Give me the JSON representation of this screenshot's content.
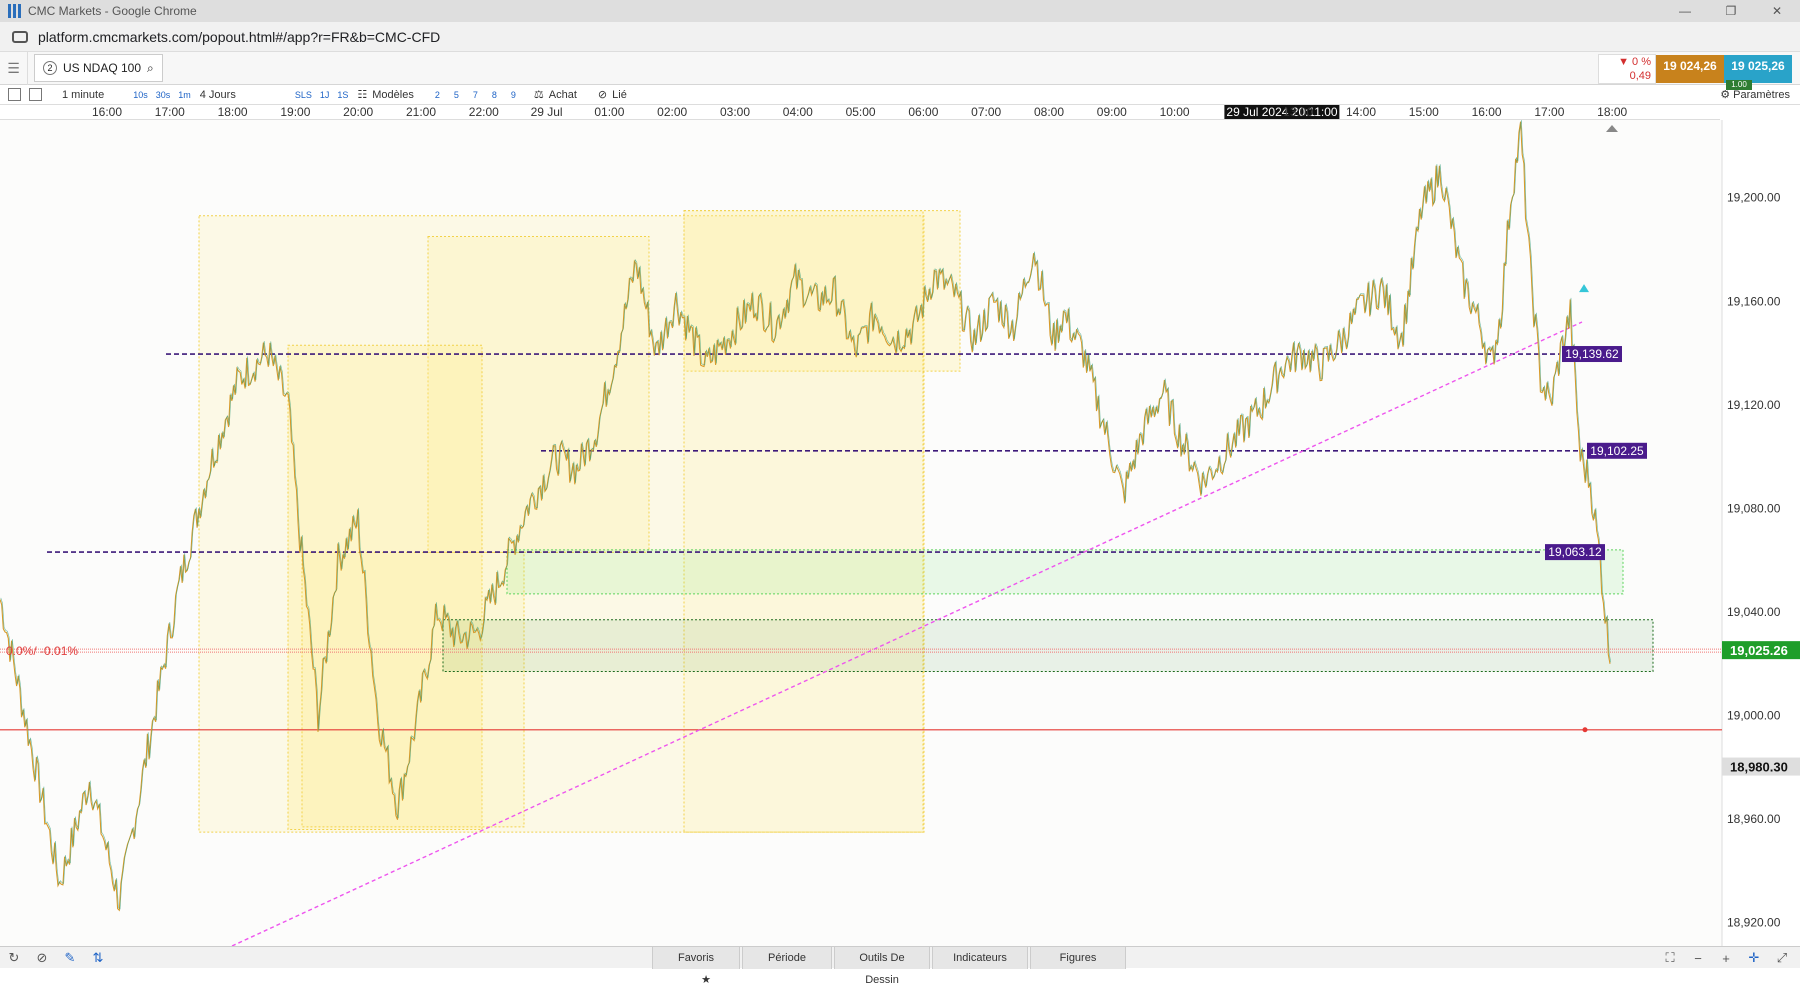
{
  "window": {
    "title": "CMC Markets - Google Chrome",
    "controls": [
      "—",
      "❐",
      "✕"
    ]
  },
  "browser": {
    "url": "platform.cmcmarkets.com/popout.html#/app?r=FR&b=CMC-CFD"
  },
  "instrument": {
    "index": "2",
    "name": "US NDAQ 100"
  },
  "price": {
    "change_pct": "▼ 0 %",
    "change_val": "0,49",
    "sell": "19 024,26",
    "buy": "19 025,26",
    "spread": "1.00"
  },
  "toolbar": {
    "interval": "1 minute",
    "quick_intervals": [
      "10s",
      "30s",
      "1m"
    ],
    "period": "4 Jours",
    "quick_periods": [
      "SLS",
      "1J",
      "1S"
    ],
    "templates": "Modèles",
    "template_nums": [
      "2",
      "5",
      "7",
      "8",
      "9"
    ],
    "buy": "Achat",
    "linked": "Lié",
    "settings": "Paramètres"
  },
  "time_axis": {
    "labels": [
      "16:00",
      "17:00",
      "18:00",
      "19:00",
      "20:00",
      "21:00",
      "22:00",
      "29 Jul",
      "01:00",
      "02:00",
      "03:00",
      "04:00",
      "05:00",
      "06:00",
      "07:00",
      "08:00",
      "09:00",
      "10:00",
      "29 Jul 2024 20:11:00",
      "13:00",
      "14:00",
      "15:00",
      "16:00",
      "17:00",
      "18:00"
    ]
  },
  "chart_data": {
    "type": "line",
    "instrument": "US NDAQ 100",
    "interval": "1 minute",
    "y_ticks": [
      19200,
      19160,
      19120,
      19080,
      19040,
      19000,
      18960,
      18920
    ],
    "y_tick_labels": [
      "19,200.00",
      "19,160.00",
      "19,120.00",
      "19,080.00",
      "19,040.00",
      "19,000.00",
      "18,960.00",
      "18,920.00"
    ],
    "ylim": [
      18911,
      19230
    ],
    "current_price_label": "19,025.26",
    "current_price": 19025.26,
    "crosshair_label": "18,980.30",
    "crosshair_price": 18980.3,
    "red_line_price": 18994.5,
    "pct_label": "0.0%/ -0.01%",
    "level_lines": [
      {
        "label": "19,139.62",
        "price": 19139.62
      },
      {
        "label": "19,102.25",
        "price": 19102.25
      },
      {
        "label": "19,063.12",
        "price": 19063.12
      }
    ],
    "zones": [
      {
        "kind": "green",
        "top": 19064,
        "bottom": 19047
      },
      {
        "kind": "dark-green",
        "top": 19037,
        "bottom": 19017
      }
    ],
    "anchors": [
      [
        0,
        19045
      ],
      [
        3,
        18990
      ],
      [
        6,
        18935
      ],
      [
        9,
        18975
      ],
      [
        12,
        18928
      ],
      [
        15,
        18990
      ],
      [
        18,
        19050
      ],
      [
        21,
        19095
      ],
      [
        24,
        19130
      ],
      [
        27,
        19140
      ],
      [
        29,
        19120
      ],
      [
        30,
        19075
      ],
      [
        32,
        19000
      ],
      [
        34,
        19060
      ],
      [
        36,
        19075
      ],
      [
        38,
        19000
      ],
      [
        40,
        18965
      ],
      [
        42,
        19000
      ],
      [
        44,
        19040
      ],
      [
        46,
        19030
      ],
      [
        48,
        19032
      ],
      [
        50,
        19050
      ],
      [
        53,
        19080
      ],
      [
        56,
        19100
      ],
      [
        58,
        19095
      ],
      [
        60,
        19110
      ],
      [
        62,
        19140
      ],
      [
        64,
        19175
      ],
      [
        66,
        19140
      ],
      [
        68,
        19160
      ],
      [
        71,
        19135
      ],
      [
        74,
        19150
      ],
      [
        76,
        19160
      ],
      [
        78,
        19150
      ],
      [
        80,
        19168
      ],
      [
        82,
        19160
      ],
      [
        84,
        19163
      ],
      [
        86,
        19140
      ],
      [
        88,
        19155
      ],
      [
        90,
        19145
      ],
      [
        92,
        19150
      ],
      [
        94,
        19170
      ],
      [
        96,
        19163
      ],
      [
        98,
        19145
      ],
      [
        100,
        19160
      ],
      [
        102,
        19150
      ],
      [
        104,
        19180
      ],
      [
        106,
        19145
      ],
      [
        107,
        19155
      ],
      [
        109,
        19140
      ],
      [
        111,
        19113
      ],
      [
        113,
        19085
      ],
      [
        115,
        19110
      ],
      [
        117,
        19125
      ],
      [
        119,
        19105
      ],
      [
        121,
        19090
      ],
      [
        123,
        19100
      ],
      [
        125,
        19110
      ],
      [
        127,
        19120
      ],
      [
        129,
        19135
      ],
      [
        131,
        19140
      ],
      [
        133,
        19135
      ],
      [
        135,
        19145
      ],
      [
        137,
        19158
      ],
      [
        139,
        19165
      ],
      [
        141,
        19145
      ],
      [
        143,
        19195
      ],
      [
        145,
        19210
      ],
      [
        147,
        19170
      ],
      [
        149,
        19150
      ],
      [
        150,
        19135
      ],
      [
        151,
        19155
      ],
      [
        152,
        19200
      ],
      [
        153,
        19225
      ],
      [
        154,
        19170
      ],
      [
        155,
        19130
      ],
      [
        156,
        19120
      ],
      [
        157,
        19140
      ],
      [
        158,
        19155
      ],
      [
        159,
        19100
      ],
      [
        160,
        19090
      ],
      [
        161,
        19060
      ],
      [
        162,
        19020
      ]
    ]
  }
}
